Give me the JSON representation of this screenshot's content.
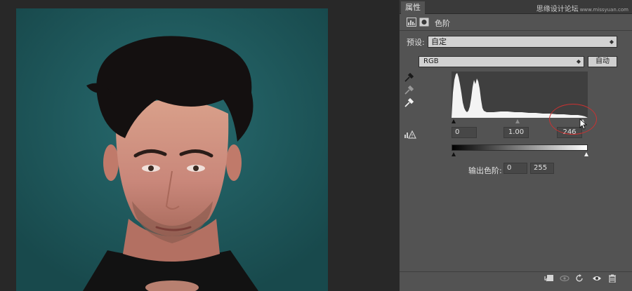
{
  "panel": {
    "tab_label": "属性",
    "title": "色阶",
    "header_icons": [
      "levels-adjustment-icon",
      "layer-mask-icon"
    ]
  },
  "watermark": {
    "text": "思缘设计论坛",
    "subtext": "www.missyuan.com"
  },
  "preset": {
    "label": "预设:",
    "value": "自定"
  },
  "channel": {
    "value": "RGB",
    "auto_label": "自动"
  },
  "eyedroppers": [
    "black-point-eyedropper-icon",
    "gray-point-eyedropper-icon",
    "white-point-eyedropper-icon"
  ],
  "input_levels": {
    "black": "0",
    "gamma": "1.00",
    "white": "246"
  },
  "output_levels": {
    "label": "输出色阶:",
    "black": "0",
    "white": "255"
  },
  "footer_icons": [
    "clip-to-layer-icon",
    "view-previous-icon",
    "reset-icon",
    "visibility-eye-icon",
    "trash-icon"
  ],
  "colors": {
    "canvas_background": "#1f5a5d",
    "panel_background": "#535353",
    "annotation_circle": "#c83232"
  }
}
